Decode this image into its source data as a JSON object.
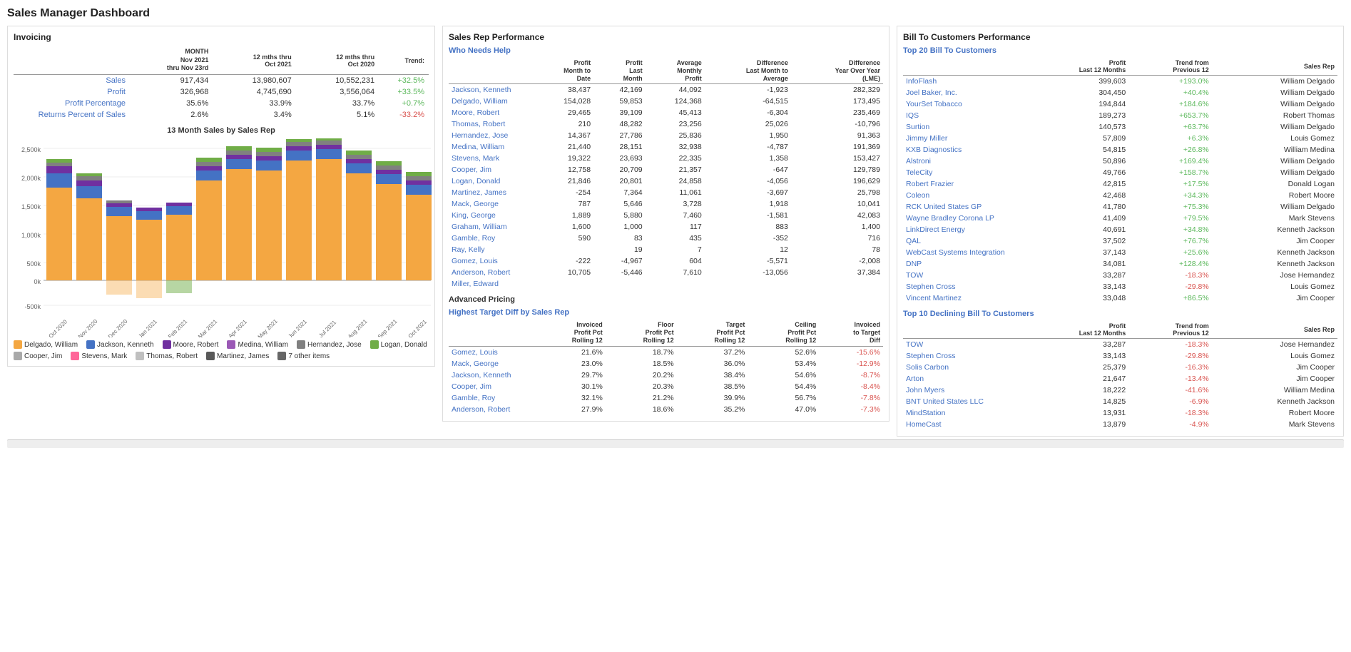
{
  "title": "Sales Manager Dashboard",
  "invoicing": {
    "section_title": "Invoicing",
    "columns": [
      "",
      "MONTH\nNov 2021\nthru Nov 23rd",
      "12 mths thru\nOct 2021",
      "12 mths thru\nOct 2020",
      "Trend:"
    ],
    "rows": [
      {
        "label": "Sales",
        "col1": "917,434",
        "col2": "13,980,607",
        "col3": "10,552,231",
        "trend": "+32.5%",
        "trend_class": "green"
      },
      {
        "label": "Profit",
        "col1": "326,968",
        "col2": "4,745,690",
        "col3": "3,556,064",
        "trend": "+33.5%",
        "trend_class": "green"
      },
      {
        "label": "Profit Percentage",
        "col1": "35.6%",
        "col2": "33.9%",
        "col3": "33.7%",
        "trend": "+0.7%",
        "trend_class": "green"
      },
      {
        "label": "Returns Percent of Sales",
        "col1": "2.6%",
        "col2": "3.4%",
        "col3": "5.1%",
        "trend": "-33.2%",
        "trend_class": "red"
      }
    ],
    "chart_title": "13 Month Sales by Sales Rep",
    "chart_months": [
      "Oct 2020",
      "Nov 2020",
      "Dec 2020",
      "Jan 2021",
      "Feb 2021",
      "Mar 2021",
      "Apr 2021",
      "May 2021",
      "Jun 2021",
      "Jul 2021",
      "Aug 2021",
      "Sep 2021",
      "Oct 2021"
    ],
    "legend": [
      {
        "name": "Delgado, William",
        "color": "#f4a742"
      },
      {
        "name": "Jackson, Kenneth",
        "color": "#4472c4"
      },
      {
        "name": "Moore, Robert",
        "color": "#7030a0"
      },
      {
        "name": "Medina, William",
        "color": "#9b59b6"
      },
      {
        "name": "Hernandez, Jose",
        "color": "#808080"
      },
      {
        "name": "Logan, Donald",
        "color": "#70ad47"
      },
      {
        "name": "Cooper, Jim",
        "color": "#a9a9a9"
      },
      {
        "name": "Stevens, Mark",
        "color": "#ff6699"
      },
      {
        "name": "Thomas, Robert",
        "color": "#c0c0c0"
      },
      {
        "name": "Martinez, James",
        "color": "#595959"
      },
      {
        "name": "7 other items",
        "color": "#666666"
      }
    ]
  },
  "sales_rep": {
    "section_title": "Sales Rep Performance",
    "who_needs_help_title": "Who Needs Help",
    "columns": [
      "",
      "Profit\nMonth to\nDate",
      "Profit\nLast\nMonth",
      "Average\nMonthly\nProfit",
      "Difference\nLast Month to\nAverage",
      "Difference\nYear Over Year\n(LME)"
    ],
    "rows": [
      {
        "name": "Jackson, Kenneth",
        "c1": "38,437",
        "c2": "42,169",
        "c3": "44,092",
        "c4": "-1,923",
        "c5": "282,329"
      },
      {
        "name": "Delgado, William",
        "c1": "154,028",
        "c2": "59,853",
        "c3": "124,368",
        "c4": "-64,515",
        "c5": "173,495"
      },
      {
        "name": "Moore, Robert",
        "c1": "29,465",
        "c2": "39,109",
        "c3": "45,413",
        "c4": "-6,304",
        "c5": "235,469"
      },
      {
        "name": "Thomas, Robert",
        "c1": "210",
        "c2": "48,282",
        "c3": "23,256",
        "c4": "25,026",
        "c5": "-10,796"
      },
      {
        "name": "Hernandez, Jose",
        "c1": "14,367",
        "c2": "27,786",
        "c3": "25,836",
        "c4": "1,950",
        "c5": "91,363"
      },
      {
        "name": "Medina, William",
        "c1": "21,440",
        "c2": "28,151",
        "c3": "32,938",
        "c4": "-4,787",
        "c5": "191,369"
      },
      {
        "name": "Stevens, Mark",
        "c1": "19,322",
        "c2": "23,693",
        "c3": "22,335",
        "c4": "1,358",
        "c5": "153,427"
      },
      {
        "name": "Cooper, Jim",
        "c1": "12,758",
        "c2": "20,709",
        "c3": "21,357",
        "c4": "-647",
        "c5": "129,789"
      },
      {
        "name": "Logan, Donald",
        "c1": "21,846",
        "c2": "20,801",
        "c3": "24,858",
        "c4": "-4,056",
        "c5": "196,629"
      },
      {
        "name": "Martinez, James",
        "c1": "-254",
        "c2": "7,364",
        "c3": "11,061",
        "c4": "-3,697",
        "c5": "25,798"
      },
      {
        "name": "Mack, George",
        "c1": "787",
        "c2": "5,646",
        "c3": "3,728",
        "c4": "1,918",
        "c5": "10,041"
      },
      {
        "name": "King, George",
        "c1": "1,889",
        "c2": "5,880",
        "c3": "7,460",
        "c4": "-1,581",
        "c5": "42,083"
      },
      {
        "name": "Graham, William",
        "c1": "1,600",
        "c2": "1,000",
        "c3": "117",
        "c4": "883",
        "c5": "1,400"
      },
      {
        "name": "Gamble, Roy",
        "c1": "590",
        "c2": "83",
        "c3": "435",
        "c4": "-352",
        "c5": "716"
      },
      {
        "name": "Ray, Kelly",
        "c1": "",
        "c2": "19",
        "c3": "7",
        "c4": "12",
        "c5": "78"
      },
      {
        "name": "Gomez, Louis",
        "c1": "-222",
        "c2": "-4,967",
        "c3": "604",
        "c4": "-5,571",
        "c5": "-2,008"
      },
      {
        "name": "Anderson, Robert",
        "c1": "10,705",
        "c2": "-5,446",
        "c3": "7,610",
        "c4": "-13,056",
        "c5": "37,384"
      },
      {
        "name": "Miller, Edward",
        "c1": "",
        "c2": "",
        "c3": "",
        "c4": "",
        "c5": ""
      }
    ],
    "advanced_pricing_title": "Advanced Pricing",
    "highest_target_title": "Highest Target Diff by Sales Rep",
    "adv_columns": [
      "",
      "Invoiced\nProfit Pct\nRolling 12",
      "Floor\nProfit Pct\nRolling 12",
      "Target\nProfit Pct\nRolling 12",
      "Ceiling\nProfit Pct\nRolling 12",
      "Invoiced\nto Target\nDiff"
    ],
    "adv_rows": [
      {
        "name": "Gomez, Louis",
        "c1": "21.6%",
        "c2": "18.7%",
        "c3": "37.2%",
        "c4": "52.6%",
        "c5": "-15.6%"
      },
      {
        "name": "Mack, George",
        "c1": "23.0%",
        "c2": "18.5%",
        "c3": "36.0%",
        "c4": "53.4%",
        "c5": "-12.9%"
      },
      {
        "name": "Jackson, Kenneth",
        "c1": "29.7%",
        "c2": "20.2%",
        "c3": "38.4%",
        "c4": "54.6%",
        "c5": "-8.7%"
      },
      {
        "name": "Cooper, Jim",
        "c1": "30.1%",
        "c2": "20.3%",
        "c3": "38.5%",
        "c4": "54.4%",
        "c5": "-8.4%"
      },
      {
        "name": "Gamble, Roy",
        "c1": "32.1%",
        "c2": "21.2%",
        "c3": "39.9%",
        "c4": "56.7%",
        "c5": "-7.8%"
      },
      {
        "name": "Anderson, Robert",
        "c1": "27.9%",
        "c2": "18.6%",
        "c3": "35.2%",
        "c4": "47.0%",
        "c5": "-7.3%"
      }
    ]
  },
  "bill_to_customers": {
    "section_title": "Bill To Customers Performance",
    "top20_title": "Top 20 Bill To Customers",
    "top20_columns": [
      "",
      "Profit\nLast 12 Months",
      "Trend from\nPrevious 12",
      "Sales Rep"
    ],
    "top20_rows": [
      {
        "name": "InfoFlash",
        "profit": "399,603",
        "trend": "+193.0%",
        "rep": "William Delgado"
      },
      {
        "name": "Joel Baker, Inc.",
        "profit": "304,450",
        "trend": "+40.4%",
        "rep": "William Delgado"
      },
      {
        "name": "YourSet Tobacco",
        "profit": "194,844",
        "trend": "+184.6%",
        "rep": "William Delgado"
      },
      {
        "name": "IQS",
        "profit": "189,273",
        "trend": "+653.7%",
        "rep": "Robert Thomas"
      },
      {
        "name": "Surtion",
        "profit": "140,573",
        "trend": "+63.7%",
        "rep": "William Delgado"
      },
      {
        "name": "Jimmy Miller",
        "profit": "57,809",
        "trend": "+6.3%",
        "rep": "Louis Gomez"
      },
      {
        "name": "KXB Diagnostics",
        "profit": "54,815",
        "trend": "+26.8%",
        "rep": "William Medina"
      },
      {
        "name": "Alstroni",
        "profit": "50,896",
        "trend": "+169.4%",
        "rep": "William Delgado"
      },
      {
        "name": "TeleCity",
        "profit": "49,766",
        "trend": "+158.7%",
        "rep": "William Delgado"
      },
      {
        "name": "Robert Frazier",
        "profit": "42,815",
        "trend": "+17.5%",
        "rep": "Donald Logan"
      },
      {
        "name": "Coleon",
        "profit": "42,468",
        "trend": "+34.3%",
        "rep": "Robert Moore"
      },
      {
        "name": "RCK United States GP",
        "profit": "41,780",
        "trend": "+75.3%",
        "rep": "William Delgado"
      },
      {
        "name": "Wayne Bradley Corona LP",
        "profit": "41,409",
        "trend": "+79.5%",
        "rep": "Mark Stevens"
      },
      {
        "name": "LinkDirect Energy",
        "profit": "40,691",
        "trend": "+34.8%",
        "rep": "Kenneth Jackson"
      },
      {
        "name": "QAL",
        "profit": "37,502",
        "trend": "+76.7%",
        "rep": "Jim Cooper"
      },
      {
        "name": "WebCast Systems Integration",
        "profit": "37,143",
        "trend": "+25.6%",
        "rep": "Kenneth Jackson"
      },
      {
        "name": "DNP",
        "profit": "34,081",
        "trend": "+128.4%",
        "rep": "Kenneth Jackson"
      },
      {
        "name": "TOW",
        "profit": "33,287",
        "trend": "-18.3%",
        "rep": "Jose Hernandez"
      },
      {
        "name": "Stephen Cross",
        "profit": "33,143",
        "trend": "-29.8%",
        "rep": "Louis Gomez"
      },
      {
        "name": "Vincent Martinez",
        "profit": "33,048",
        "trend": "+86.5%",
        "rep": "Jim Cooper"
      }
    ],
    "top10_declining_title": "Top 10 Declining Bill To Customers",
    "top10_columns": [
      "",
      "Profit\nLast 12 Months",
      "Trend from\nPrevious 12",
      "Sales Rep"
    ],
    "top10_rows": [
      {
        "name": "TOW",
        "profit": "33,287",
        "trend": "-18.3%",
        "rep": "Jose Hernandez"
      },
      {
        "name": "Stephen Cross",
        "profit": "33,143",
        "trend": "-29.8%",
        "rep": "Louis Gomez"
      },
      {
        "name": "Solis Carbon",
        "profit": "25,379",
        "trend": "-16.3%",
        "rep": "Jim Cooper"
      },
      {
        "name": "Arton",
        "profit": "21,647",
        "trend": "-13.4%",
        "rep": "Jim Cooper"
      },
      {
        "name": "John Myers",
        "profit": "18,222",
        "trend": "-41.6%",
        "rep": "William Medina"
      },
      {
        "name": "BNT United States LLC",
        "profit": "14,825",
        "trend": "-6.9%",
        "rep": "Kenneth Jackson"
      },
      {
        "name": "MindStation",
        "profit": "13,931",
        "trend": "-18.3%",
        "rep": "Robert Moore"
      },
      {
        "name": "HomeCast",
        "profit": "13,879",
        "trend": "-4.9%",
        "rep": "Mark Stevens"
      }
    ]
  }
}
